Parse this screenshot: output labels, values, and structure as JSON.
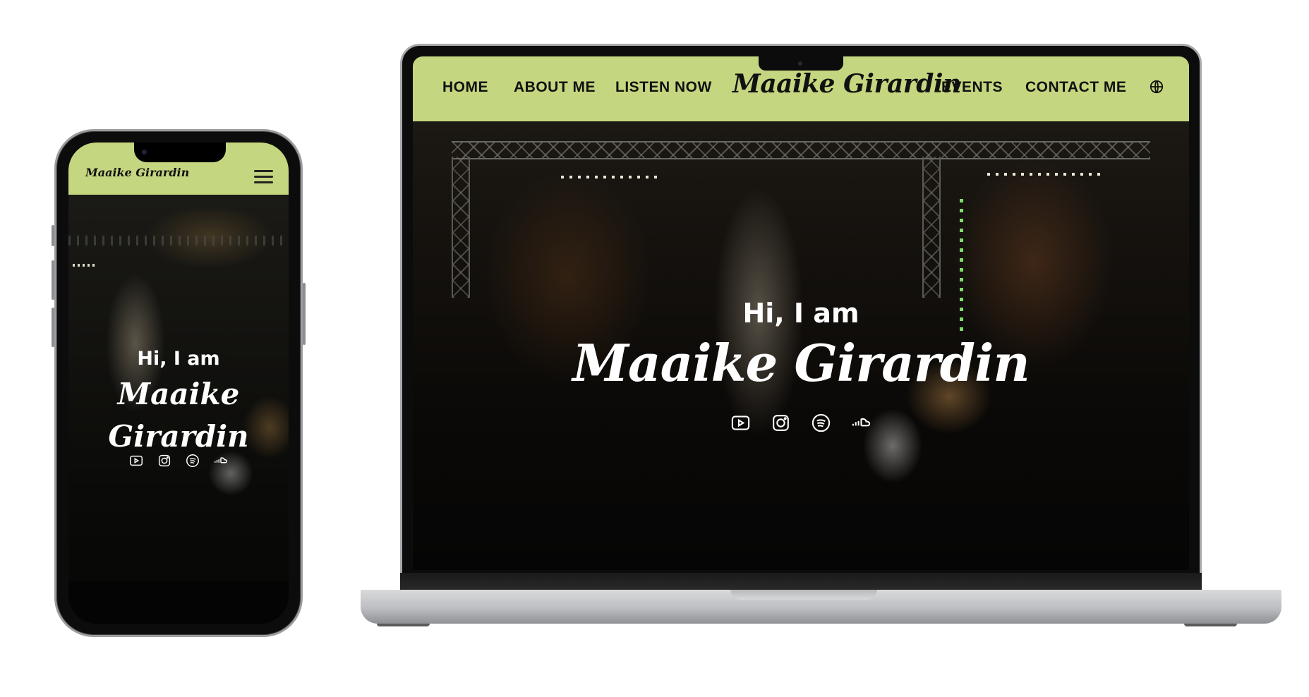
{
  "site": {
    "brand": "Maaike Girardin",
    "accent_color": "#c4d67f",
    "text_color": "#111111"
  },
  "nav": {
    "items": [
      {
        "label": "HOME"
      },
      {
        "label": "ABOUT ME"
      },
      {
        "label": "LISTEN NOW"
      },
      {
        "label": "EVENTS"
      },
      {
        "label": "CONTACT ME"
      }
    ],
    "language_icon": "globe-icon"
  },
  "hero": {
    "greeting": "Hi, I am",
    "name": "Maaike Girardin",
    "name_line1": "Maaike",
    "name_line2": "Girardin",
    "social_icons": [
      "youtube-icon",
      "instagram-icon",
      "spotify-icon",
      "soundcloud-icon"
    ]
  },
  "mobile": {
    "menu_icon": "hamburger-menu-icon"
  }
}
